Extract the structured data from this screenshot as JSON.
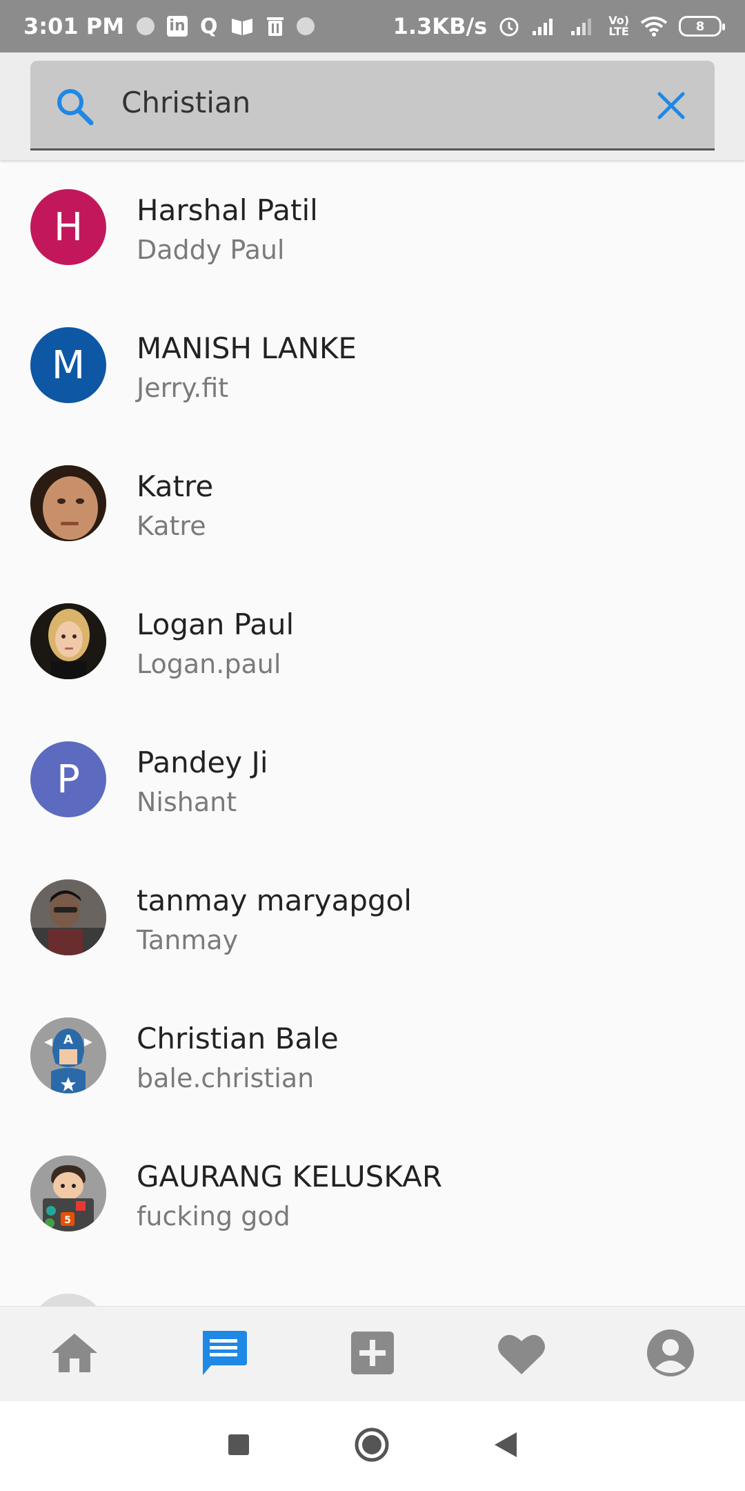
{
  "status_bar": {
    "time": "3:01 PM",
    "network_speed": "1.3KB/s",
    "battery_level": "8",
    "icons": [
      "circle-icon",
      "linkedin-icon",
      "quora-icon",
      "book-icon",
      "trash-icon",
      "circle-icon",
      "alarm-icon",
      "signal-icon",
      "signal-icon",
      "volte-icon",
      "wifi-icon",
      "battery-icon"
    ]
  },
  "search": {
    "value": "Christian",
    "placeholder": "",
    "icon": "search-icon",
    "clear_icon": "close-icon",
    "accent": "#1E88E5"
  },
  "contacts": [
    {
      "name": "Harshal Patil",
      "subtitle": "Daddy Paul",
      "initial": "H",
      "avatar_color": "#C2185B"
    },
    {
      "name": "MANISH LANKE",
      "subtitle": "Jerry.fit",
      "initial": "M",
      "avatar_color": "#0D57A5"
    },
    {
      "name": "Katre",
      "subtitle": "Katre",
      "initial": "",
      "avatar_color": "#7a5238"
    },
    {
      "name": "Logan Paul",
      "subtitle": "Logan.paul",
      "initial": "",
      "avatar_color": "#3b2f22"
    },
    {
      "name": "Pandey Ji",
      "subtitle": "Nishant",
      "initial": "P",
      "avatar_color": "#5C6BC0"
    },
    {
      "name": "tanmay maryapgol",
      "subtitle": "Tanmay",
      "initial": "",
      "avatar_color": "#4a3a3a"
    },
    {
      "name": "Christian Bale",
      "subtitle": "bale.christian",
      "initial": "",
      "avatar_color": "#9e9e9e"
    },
    {
      "name": "GAURANG KELUSKAR",
      "subtitle": "fucking god",
      "initial": "",
      "avatar_color": "#9e9e9e"
    }
  ],
  "bottom_nav": [
    {
      "icon": "home-icon",
      "active": false
    },
    {
      "icon": "chat-icon",
      "active": true
    },
    {
      "icon": "add-box-icon",
      "active": false
    },
    {
      "icon": "heart-icon",
      "active": false
    },
    {
      "icon": "account-icon",
      "active": false
    }
  ],
  "colors": {
    "nav_active": "#1E88E5",
    "nav_inactive": "#8a8a8a"
  },
  "system_nav": [
    "recents-icon",
    "home-circle-icon",
    "back-icon"
  ]
}
